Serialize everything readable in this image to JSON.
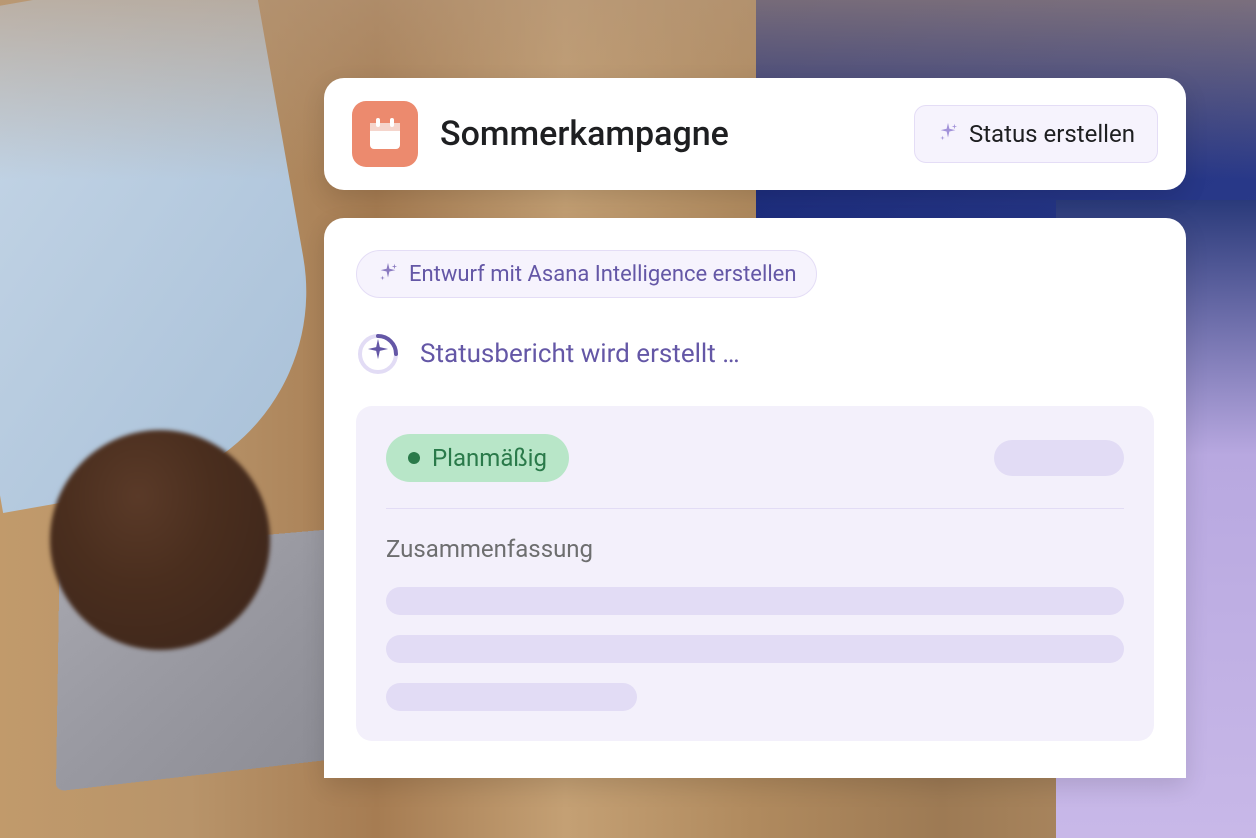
{
  "header": {
    "project_title": "Sommerkampagne",
    "status_button_label": "Status erstellen",
    "icon_name": "calendar-icon"
  },
  "main": {
    "draft_chip_label": "Entwurf mit Asana Intelligence erstellen",
    "generating_label": "Statusbericht wird erstellt …",
    "report": {
      "status_label": "Planmäßig",
      "status_color": "#2a7a4a",
      "status_bg": "#b8e6c8",
      "summary_heading": "Zusammenfassung"
    }
  },
  "colors": {
    "accent_purple": "#6457a6",
    "panel_bg": "#f3f0fb",
    "chip_bg": "#f6f3fd",
    "project_icon_bg": "#ec8a6e"
  }
}
